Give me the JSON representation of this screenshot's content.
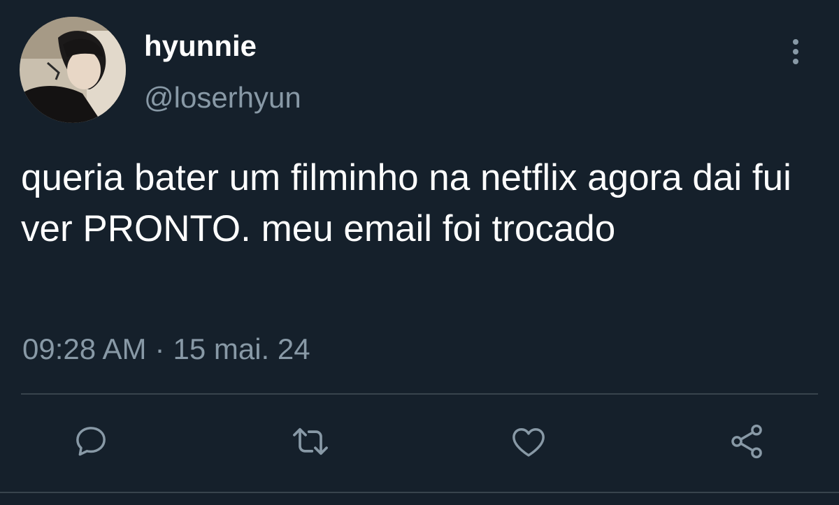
{
  "author": {
    "display_name": "hyunnie",
    "handle": "@loserhyun"
  },
  "tweet": {
    "text": "queria bater um filminho na netflix agora dai fui ver PRONTO. meu email foi trocado",
    "time": "09:28 AM",
    "separator": "·",
    "date": "15 mai. 24"
  },
  "colors": {
    "background": "#15202b",
    "primary_text": "#ffffff",
    "secondary_text": "#8899a6",
    "divider": "#38444d"
  },
  "icons": {
    "more": "more-vertical-icon",
    "reply": "reply-icon",
    "retweet": "retweet-icon",
    "like": "heart-icon",
    "share": "share-icon"
  }
}
